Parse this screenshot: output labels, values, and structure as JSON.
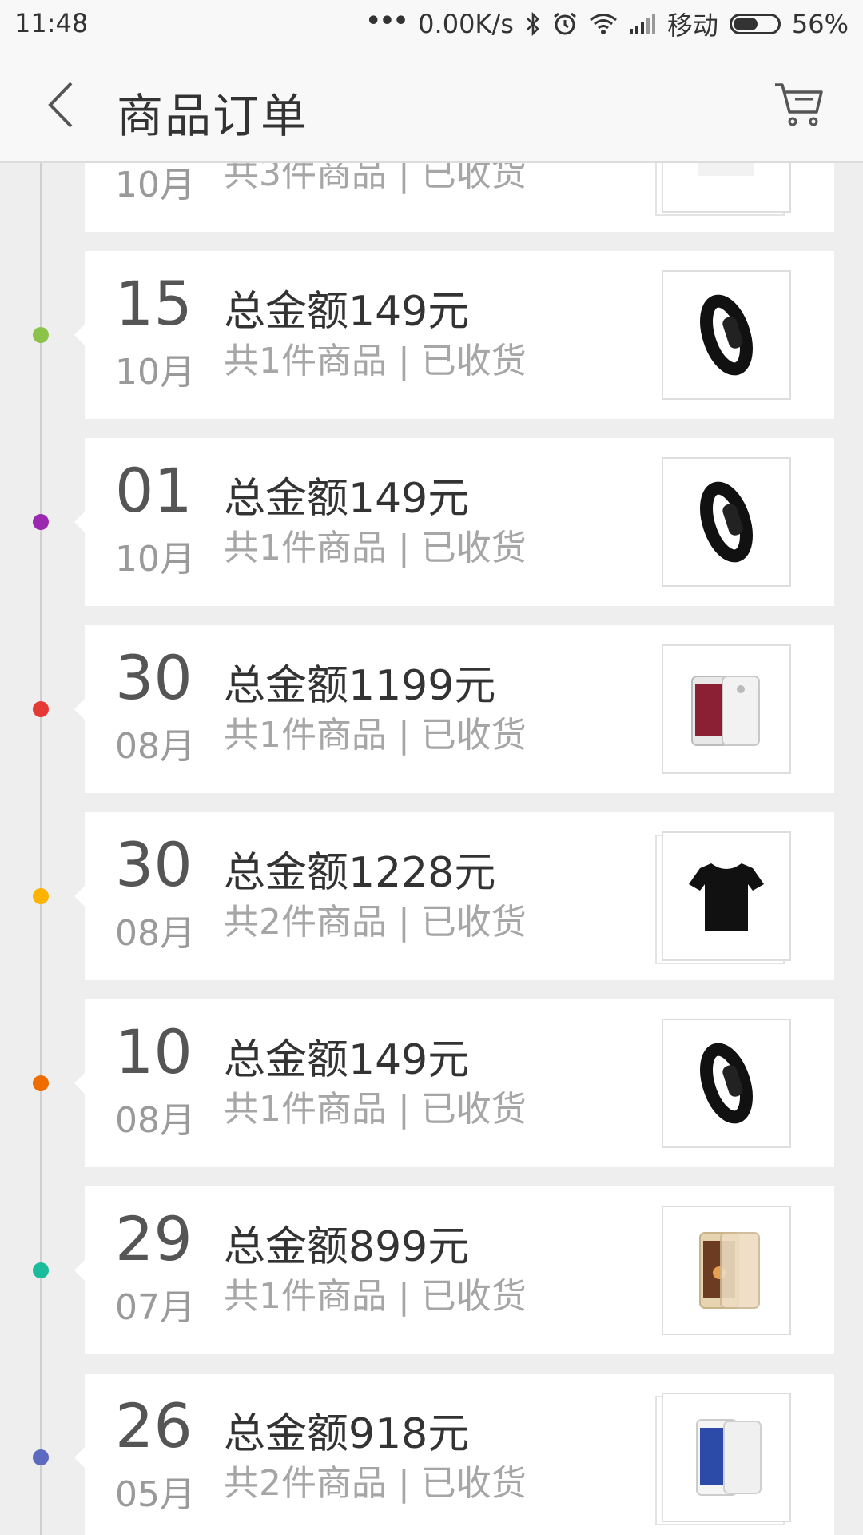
{
  "status_bar": {
    "time": "11:48",
    "network_speed": "0.00K/s",
    "carrier": "移动",
    "battery_text": "56%",
    "battery_level": 0.56,
    "icons": [
      "more-dots-icon",
      "bluetooth-icon",
      "alarm-icon",
      "wifi-icon",
      "signal-icon",
      "battery-icon"
    ]
  },
  "header": {
    "title": "商品订单",
    "back_icon": "chevron-left-icon",
    "cart_icon": "cart-icon"
  },
  "orders": [
    {
      "day": "",
      "month": "10月",
      "total": "",
      "summary": "共3件商品 | 已收货",
      "dot_color": "#cccccc",
      "product": "generic",
      "stacked": true
    },
    {
      "day": "15",
      "month": "10月",
      "total": "总金额149元",
      "summary": "共1件商品 | 已收货",
      "dot_color": "#8bc34a",
      "product": "fitness-band",
      "stacked": false
    },
    {
      "day": "01",
      "month": "10月",
      "total": "总金额149元",
      "summary": "共1件商品 | 已收货",
      "dot_color": "#9c27b0",
      "product": "fitness-band",
      "stacked": false
    },
    {
      "day": "30",
      "month": "08月",
      "total": "总金额1199元",
      "summary": "共1件商品 | 已收货",
      "dot_color": "#e53935",
      "product": "phone-silver",
      "stacked": false
    },
    {
      "day": "30",
      "month": "08月",
      "total": "总金额1228元",
      "summary": "共2件商品 | 已收货",
      "dot_color": "#ffb300",
      "product": "tshirt",
      "stacked": true
    },
    {
      "day": "10",
      "month": "08月",
      "total": "总金额149元",
      "summary": "共1件商品 | 已收货",
      "dot_color": "#ef6c00",
      "product": "fitness-band",
      "stacked": false
    },
    {
      "day": "29",
      "month": "07月",
      "total": "总金额899元",
      "summary": "共1件商品 | 已收货",
      "dot_color": "#1abc9c",
      "product": "phone-gold",
      "stacked": false
    },
    {
      "day": "26",
      "month": "05月",
      "total": "总金额918元",
      "summary": "共2件商品 | 已收货",
      "dot_color": "#5c6bc0",
      "product": "phone-white",
      "stacked": true
    }
  ]
}
